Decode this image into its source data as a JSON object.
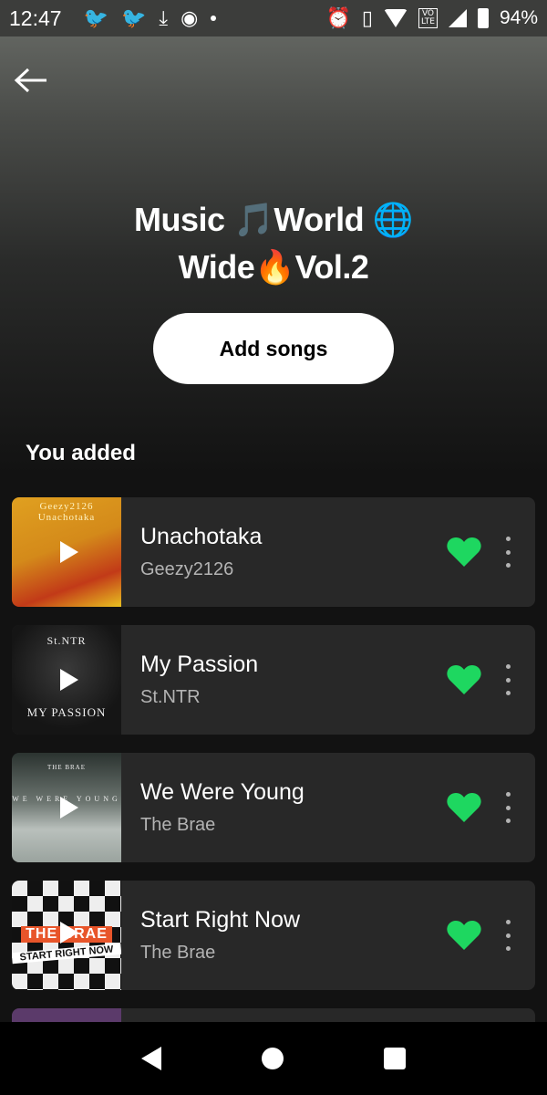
{
  "status_bar": {
    "time": "12:47",
    "battery": "94%",
    "volte_line1": "VO",
    "volte_line2": "LTE"
  },
  "playlist": {
    "title_line1": "Music 🎵World 🌐",
    "title_line2": "Wide🔥Vol.2",
    "add_songs_label": "Add songs",
    "section_title": "You added"
  },
  "songs": [
    {
      "title": "Unachotaka",
      "artist": "Geezy2126",
      "art_label": "Geezy2126 Unachotaka",
      "liked": true
    },
    {
      "title": "My Passion",
      "artist": "St.NTR",
      "art_label": "St.NTR",
      "art_label2": "MY PASSION",
      "liked": true
    },
    {
      "title": "We Were Young",
      "artist": "The Brae",
      "art_label": "THE BRAE",
      "art_label2": "WE WERE YOUNG",
      "liked": true
    },
    {
      "title": "Start Right Now",
      "artist": "The Brae",
      "art_label": "THE BRAE",
      "art_label2": "START RIGHT NOW",
      "liked": true
    }
  ],
  "colors": {
    "heart": "#1ed760",
    "row_bg": "#282828",
    "subtext": "#b3b3b3"
  }
}
